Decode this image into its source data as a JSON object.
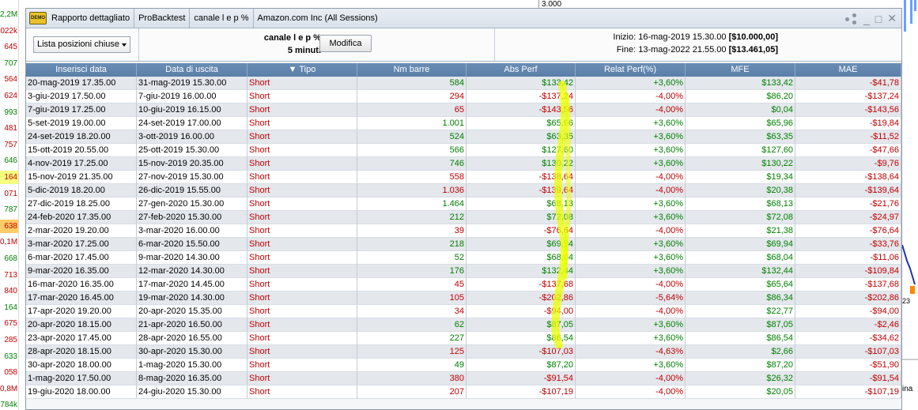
{
  "background": {
    "left_values": [
      "2,2M",
      "022k",
      "645",
      "707",
      "564",
      "624",
      "993",
      "481",
      "757",
      "646",
      "164",
      "071",
      "787",
      "638",
      "0,1M",
      "668",
      "713",
      "840",
      "164",
      "675",
      "285",
      "633",
      "058",
      "0,8M",
      "784k"
    ],
    "top_price": "3.000",
    "right_label": "23",
    "right_label2": "ina"
  },
  "window": {
    "demo_badge": "DEMO",
    "tabs": [
      "Rapporto dettagliato",
      "ProBacktest",
      "canale l e p %",
      "Amazon.com Inc (All Sessions)"
    ],
    "controls": {
      "share_icon": "share-icon",
      "minimize": "_",
      "maximize": "□",
      "close": "✕"
    }
  },
  "header": {
    "list_select": "Lista posizioni chiuse",
    "strategy_name": "canale l e p %",
    "timeframe": "5 minuti",
    "modify_label": "Modifica",
    "start_label": "Inizio:",
    "start_value": "16-mag-2019 15.30.00",
    "start_capital": "[$10.000,00]",
    "end_label": "Fine:",
    "end_value": "13-mag-2022 21.55.00",
    "end_capital": "[$13.461,05]"
  },
  "table": {
    "columns": [
      "Inserisci data",
      "Data di uscita",
      "▼ Tipo",
      "Nm barre",
      "Abs Perf",
      "Relat Perf(%)",
      "MFE",
      "MAE"
    ],
    "rows": [
      [
        "20-mag-2019 17.35.00",
        "31-mag-2019 15.30.00",
        "Short",
        "584",
        "$133,42",
        "+3,60%",
        "$133,42",
        "-$41,78"
      ],
      [
        "3-giu-2019 17.50.00",
        "7-giu-2019 16.00.00",
        "Short",
        "294",
        "-$137,24",
        "-4,00%",
        "$86,20",
        "-$137,24"
      ],
      [
        "7-giu-2019 17.25.00",
        "10-giu-2019 16.15.00",
        "Short",
        "65",
        "-$143,56",
        "-4,00%",
        "$0,04",
        "-$143,56"
      ],
      [
        "5-set-2019 19.00.00",
        "24-set-2019 17.00.00",
        "Short",
        "1.001",
        "$65,96",
        "+3,60%",
        "$65,96",
        "-$19,84"
      ],
      [
        "24-set-2019 18.20.00",
        "3-ott-2019 16.00.00",
        "Short",
        "524",
        "$63,35",
        "+3,60%",
        "$63,35",
        "-$11,52"
      ],
      [
        "15-ott-2019 20.55.00",
        "25-ott-2019 15.30.00",
        "Short",
        "566",
        "$127,60",
        "+3,60%",
        "$127,60",
        "-$47,66"
      ],
      [
        "4-nov-2019 17.25.00",
        "15-nov-2019 20.35.00",
        "Short",
        "746",
        "$130,22",
        "+3,60%",
        "$130,22",
        "-$9,76"
      ],
      [
        "15-nov-2019 21.35.00",
        "27-nov-2019 15.30.00",
        "Short",
        "558",
        "-$138,64",
        "-4,00%",
        "$19,34",
        "-$138,64"
      ],
      [
        "5-dic-2019 18.20.00",
        "26-dic-2019 15.55.00",
        "Short",
        "1.036",
        "-$139,64",
        "-4,00%",
        "$20,38",
        "-$139,64"
      ],
      [
        "27-dic-2019 18.25.00",
        "27-gen-2020 15.30.00",
        "Short",
        "1.464",
        "$68,13",
        "+3,60%",
        "$68,13",
        "-$21,76"
      ],
      [
        "24-feb-2020 17.35.00",
        "27-feb-2020 15.30.00",
        "Short",
        "212",
        "$72,08",
        "+3,60%",
        "$72,08",
        "-$24,97"
      ],
      [
        "2-mar-2020 19.20.00",
        "3-mar-2020 16.00.00",
        "Short",
        "39",
        "-$76,64",
        "-4,00%",
        "$21,38",
        "-$76,64"
      ],
      [
        "3-mar-2020 17.25.00",
        "6-mar-2020 15.50.00",
        "Short",
        "218",
        "$69,94",
        "+3,60%",
        "$69,94",
        "-$33,76"
      ],
      [
        "6-mar-2020 17.45.00",
        "9-mar-2020 14.30.00",
        "Short",
        "52",
        "$68,04",
        "+3,60%",
        "$68,04",
        "-$11,06"
      ],
      [
        "9-mar-2020 16.35.00",
        "12-mar-2020 14.30.00",
        "Short",
        "176",
        "$132,44",
        "+3,60%",
        "$132,44",
        "-$109,84"
      ],
      [
        "16-mar-2020 16.35.00",
        "17-mar-2020 14.45.00",
        "Short",
        "45",
        "-$137,68",
        "-4,00%",
        "$65,64",
        "-$137,68"
      ],
      [
        "17-mar-2020 16.45.00",
        "19-mar-2020 14.30.00",
        "Short",
        "105",
        "-$202,86",
        "-5,64%",
        "$86,34",
        "-$202,86"
      ],
      [
        "17-apr-2020 19.20.00",
        "20-apr-2020 15.35.00",
        "Short",
        "34",
        "-$94,00",
        "-4,00%",
        "$22,77",
        "-$94,00"
      ],
      [
        "20-apr-2020 18.15.00",
        "21-apr-2020 16.50.00",
        "Short",
        "62",
        "$87,05",
        "+3,60%",
        "$87,05",
        "-$2,46"
      ],
      [
        "23-apr-2020 17.45.00",
        "28-apr-2020 16.55.00",
        "Short",
        "227",
        "$86,54",
        "+3,60%",
        "$86,54",
        "-$34,62"
      ],
      [
        "28-apr-2020 18.15.00",
        "30-apr-2020 15.30.00",
        "Short",
        "125",
        "-$107,03",
        "-4,63%",
        "$2,66",
        "-$107,03"
      ],
      [
        "30-apr-2020 18.00.00",
        "1-mag-2020 15.30.00",
        "Short",
        "49",
        "$87,20",
        "+3,60%",
        "$87,20",
        "-$51,90"
      ],
      [
        "1-mag-2020 17.50.00",
        "8-mag-2020 16.35.00",
        "Short",
        "380",
        "-$91,54",
        "-4,00%",
        "$26,32",
        "-$91,54"
      ],
      [
        "19-giu-2020 18.00.00",
        "24-giu-2020 15.30.00",
        "Short",
        "207",
        "-$107,19",
        "-4,00%",
        "$20,05",
        "-$107,19"
      ]
    ]
  },
  "colors": {
    "header_blue": "#5f83ad",
    "positive": "#008000",
    "negative": "#c00000",
    "highlight": "#f2ff00"
  }
}
